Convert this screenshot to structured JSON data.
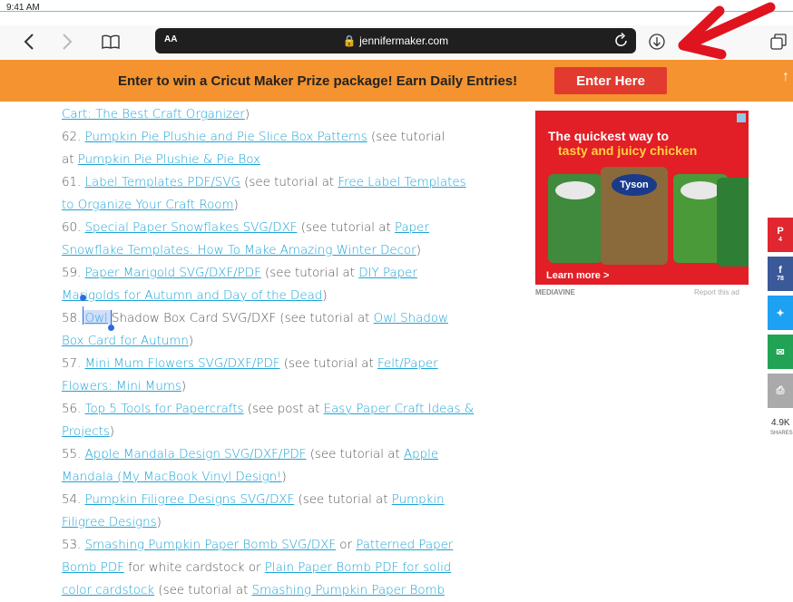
{
  "status": {
    "time": "9:41 AM"
  },
  "toolbar": {
    "address_aa": "AA",
    "domain": "jennifermaker.com"
  },
  "banner": {
    "message": "Enter to win a Cricut Maker Prize package! Earn Daily Entries!",
    "button": "Enter Here"
  },
  "article": {
    "lines": [
      [
        {
          "t": "Cart: The Best Craft Organizer",
          "l": 1
        },
        {
          "t": ")"
        }
      ],
      [
        {
          "t": "62. "
        },
        {
          "t": "Pumpkin Pie Plushie and Pie Slice Box Patterns",
          "l": 1
        },
        {
          "t": " (see tutorial"
        }
      ],
      [
        {
          "t": "at "
        },
        {
          "t": "Pumpkin Pie Plushie & Pie Box",
          "l": 1
        }
      ],
      [
        {
          "t": "61. "
        },
        {
          "t": "Label Templates PDF/SVG",
          "l": 1
        },
        {
          "t": " (see tutorial at "
        },
        {
          "t": "Free Label Templates",
          "l": 1
        }
      ],
      [
        {
          "t": "to Organize Your Craft Room",
          "l": 1
        },
        {
          "t": ")"
        }
      ],
      [
        {
          "t": "60. "
        },
        {
          "t": "Special Paper Snowflakes SVG/DXF",
          "l": 1
        },
        {
          "t": " (see tutorial at "
        },
        {
          "t": "Paper",
          "l": 1
        }
      ],
      [
        {
          "t": "Snowflake Templates: How To Make Amazing Winter Decor",
          "l": 1
        },
        {
          "t": ")"
        }
      ],
      [
        {
          "t": "59. "
        },
        {
          "t": "Paper Marigold SVG/DXF/PDF",
          "l": 1
        },
        {
          "t": " (see tutorial at "
        },
        {
          "t": "DIY Paper",
          "l": 1
        }
      ],
      [
        {
          "t": "Marigolds for Autumn and Day of the Dead",
          "l": 1
        },
        {
          "t": ")"
        }
      ],
      [
        {
          "t": "58. "
        },
        {
          "t": "Owl",
          "l": 1
        },
        {
          "t": " Shadow Box Card SVG/DXF (see tutorial at "
        },
        {
          "t": "Owl Shadow",
          "l": 1
        }
      ],
      [
        {
          "t": "Box Card for Autumn",
          "l": 1
        },
        {
          "t": ")"
        }
      ],
      [
        {
          "t": "57. "
        },
        {
          "t": "Mini Mum Flowers SVG/DXF/PDF",
          "l": 1
        },
        {
          "t": " (see tutorial at "
        },
        {
          "t": "Felt/Paper",
          "l": 1
        }
      ],
      [
        {
          "t": "Flowers: Mini Mums",
          "l": 1
        },
        {
          "t": ")"
        }
      ],
      [
        {
          "t": "56. "
        },
        {
          "t": "Top 5 Tools for Papercrafts",
          "l": 1
        },
        {
          "t": " (see post at "
        },
        {
          "t": "Easy Paper Craft Ideas &",
          "l": 1
        }
      ],
      [
        {
          "t": "Projects",
          "l": 1
        },
        {
          "t": ")"
        }
      ],
      [
        {
          "t": "55. "
        },
        {
          "t": "Apple Mandala Design SVG/DXF/PDF",
          "l": 1
        },
        {
          "t": " (see tutorial at "
        },
        {
          "t": "Apple",
          "l": 1
        }
      ],
      [
        {
          "t": "Mandala (My MacBook Vinyl Design!",
          "l": 1
        },
        {
          "t": ")"
        }
      ],
      [
        {
          "t": "54. "
        },
        {
          "t": "Pumpkin Filigree Designs SVG/DXF",
          "l": 1
        },
        {
          "t": " (see tutorial at "
        },
        {
          "t": "Pumpkin",
          "l": 1
        }
      ],
      [
        {
          "t": "Filigree Designs",
          "l": 1
        },
        {
          "t": ")"
        }
      ],
      [
        {
          "t": "53. "
        },
        {
          "t": "Smashing Pumpkin Paper Bomb SVG/DXF",
          "l": 1
        },
        {
          "t": " or "
        },
        {
          "t": "Patterned Paper",
          "l": 1
        }
      ],
      [
        {
          "t": "Bomb PDF",
          "l": 1
        },
        {
          "t": " for white cardstock or "
        },
        {
          "t": "Plain Paper Bomb PDF for solid",
          "l": 1
        }
      ],
      [
        {
          "t": "color cardstock",
          "l": 1
        },
        {
          "t": " (see tutorial at "
        },
        {
          "t": "Smashing Pumpkin Paper Bomb",
          "l": 1
        }
      ]
    ]
  },
  "ad": {
    "headline_1": "The quickest way to",
    "headline_2": "tasty and juicy chicken",
    "brand": "Tyson",
    "cta": "Learn more >",
    "network": "MEDIAVINE",
    "report": "Report this ad"
  },
  "share_bar": {
    "pinterest_count": "4",
    "facebook_count": "78",
    "total": "4.9K",
    "total_label": "SHARES"
  },
  "colors": {
    "banner": "#f4932f",
    "enter_button": "#e23a2e",
    "link": "#1ba3d6",
    "pinterest": "#e0262e",
    "facebook": "#3b5998",
    "twitter": "#1da1f2",
    "email": "#22a254",
    "print": "#aaaaaa"
  }
}
